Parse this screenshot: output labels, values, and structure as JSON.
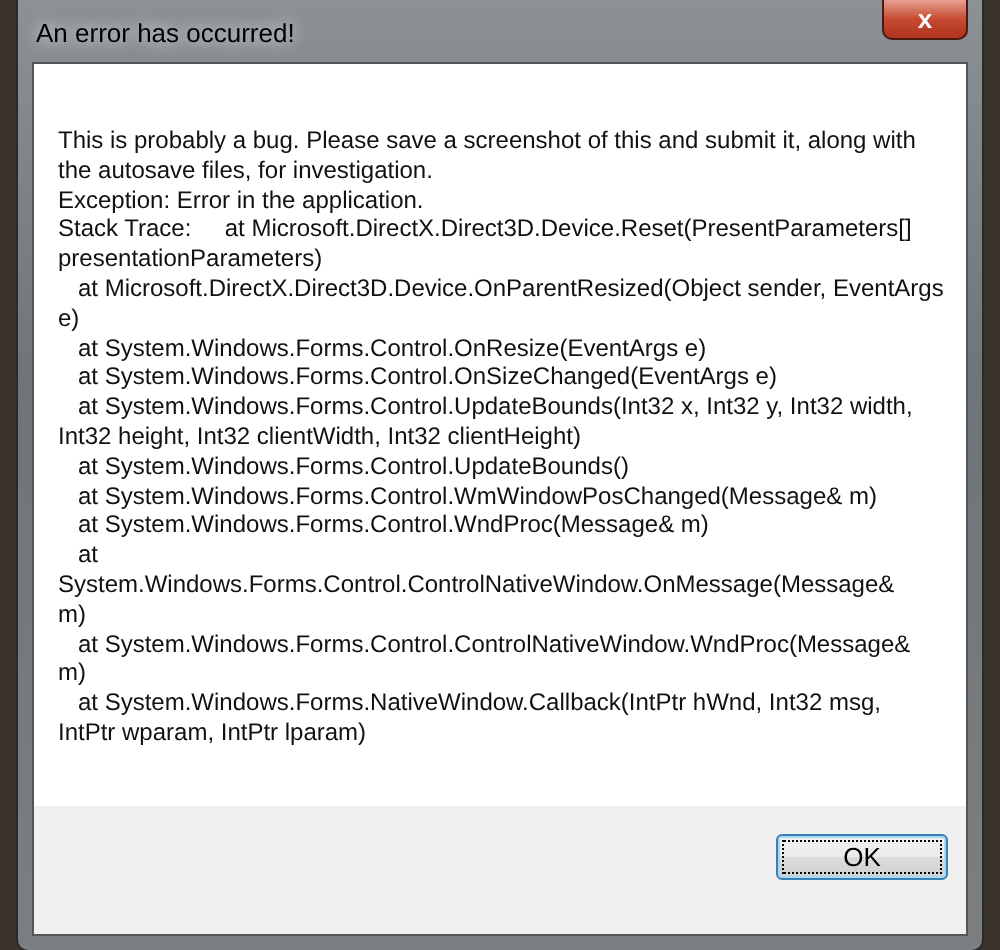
{
  "window": {
    "title": "An error has occurred!",
    "close_label": "x"
  },
  "message_lines": [
    "This is probably a bug. Please save a screenshot of this and submit it, along with",
    "the autosave files, for investigation.",
    "Exception: Error in the application.",
    "Stack Trace:     at Microsoft.DirectX.Direct3D.Device.Reset(PresentParameters[]",
    "presentationParameters)",
    "   at Microsoft.DirectX.Direct3D.Device.OnParentResized(Object sender, EventArgs",
    "e)",
    "   at System.Windows.Forms.Control.OnResize(EventArgs e)",
    "   at System.Windows.Forms.Control.OnSizeChanged(EventArgs e)",
    "   at System.Windows.Forms.Control.UpdateBounds(Int32 x, Int32 y, Int32 width,",
    "Int32 height, Int32 clientWidth, Int32 clientHeight)",
    "   at System.Windows.Forms.Control.UpdateBounds()",
    "   at System.Windows.Forms.Control.WmWindowPosChanged(Message& m)",
    "   at System.Windows.Forms.Control.WndProc(Message& m)",
    "   at",
    "System.Windows.Forms.Control.ControlNativeWindow.OnMessage(Message&",
    "m)",
    "   at System.Windows.Forms.Control.ControlNativeWindow.WndProc(Message&",
    "m)",
    "   at System.Windows.Forms.NativeWindow.Callback(IntPtr hWnd, Int32 msg,",
    "IntPtr wparam, IntPtr lparam)"
  ],
  "buttons": [
    {
      "label": "OK",
      "selected": true
    }
  ]
}
